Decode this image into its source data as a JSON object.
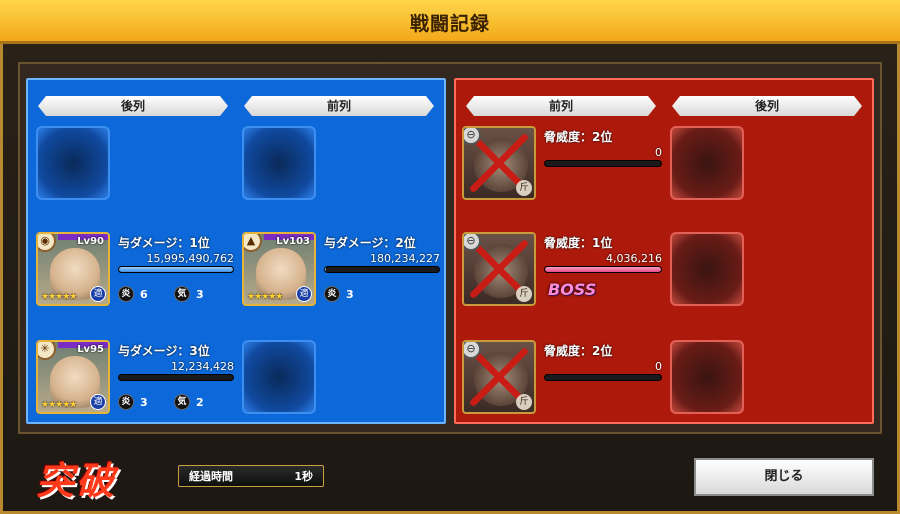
{
  "title": "戦闘記録",
  "ally": {
    "back_header": "後列",
    "front_header": "前列",
    "units": [
      {
        "rank_label": "与ダメージ：1位",
        "damage": "15,995,490,762",
        "level": "Lv90",
        "damage_fill": 1.0,
        "skill": "6",
        "ki": "3",
        "badge": "適"
      },
      {
        "rank_label": "与ダメージ：2位",
        "damage": "180,234,227",
        "level": "Lv103",
        "damage_fill": 0.01,
        "skill": "3",
        "badge": "適"
      },
      {
        "rank_label": "与ダメージ：3位",
        "damage": "12,234,428",
        "level": "Lv95",
        "damage_fill": 0.001,
        "skill": "3",
        "ki": "2",
        "badge": "適"
      }
    ],
    "chip_labels": {
      "skill": "炎",
      "ki": "気"
    }
  },
  "enemy": {
    "front_header": "前列",
    "back_header": "後列",
    "units": [
      {
        "rank_label": "脅威度：2位",
        "value": "0",
        "value_fill": 0.0,
        "sub": "斤"
      },
      {
        "rank_label": "脅威度：1位",
        "value": "4,036,216",
        "value_fill": 1.0,
        "sub": "斤",
        "boss": "BOSS"
      },
      {
        "rank_label": "脅威度：2位",
        "value": "0",
        "value_fill": 0.0,
        "sub": "斤"
      }
    ]
  },
  "footer": {
    "logo": "突破",
    "elapsed_label": "経過時間",
    "elapsed_value": "1秒",
    "close_label": "閉じる"
  }
}
